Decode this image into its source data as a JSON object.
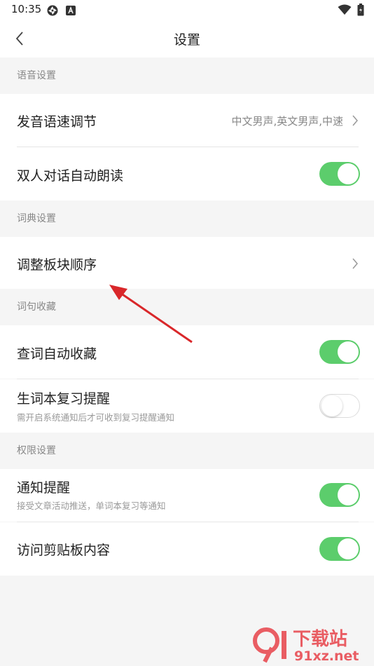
{
  "status_bar": {
    "time": "10:35"
  },
  "nav": {
    "title": "设置"
  },
  "sections": {
    "voice": {
      "header": "语音设置"
    },
    "dict": {
      "header": "词典设置"
    },
    "collect": {
      "header": "词句收藏"
    },
    "perm": {
      "header": "权限设置"
    }
  },
  "rows": {
    "pronunciation": {
      "title": "发音语速调节",
      "value": "中文男声,英文男声,中速"
    },
    "dialogue": {
      "title": "双人对话自动朗读",
      "toggle": "on"
    },
    "block_order": {
      "title": "调整板块顺序"
    },
    "auto_collect": {
      "title": "查词自动收藏",
      "toggle": "on"
    },
    "review_reminder": {
      "title": "生词本复习提醒",
      "subtitle": "需开启系统通知后才可收到复习提醒通知",
      "toggle": "off"
    },
    "notify": {
      "title": "通知提醒",
      "subtitle": "接受文章活动推送，单词本复习等通知",
      "toggle": "on"
    },
    "clipboard": {
      "title": "访问剪贴板内容",
      "toggle": "on"
    }
  },
  "colors": {
    "toggle_on": "#5ccd6c",
    "arrow": "#d9272a"
  },
  "watermark": {
    "logo_text": "下载站",
    "url": "91xz.net"
  }
}
